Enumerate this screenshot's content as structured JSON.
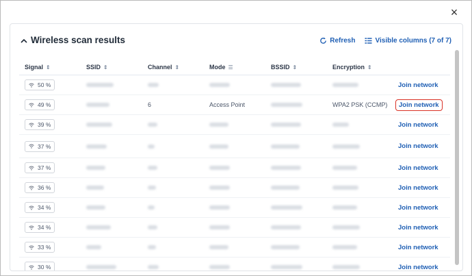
{
  "dialog": {
    "close_icon": "×"
  },
  "panel": {
    "title": "Wireless scan results",
    "refresh_label": "Refresh",
    "visible_columns_label": "Visible columns (7 of 7)"
  },
  "columns": [
    "Signal",
    "SSID",
    "Channel",
    "Mode",
    "BSSID",
    "Encryption"
  ],
  "rows": [
    {
      "signal": "50 %",
      "ssid": "",
      "channel": "",
      "mode": "",
      "bssid": "",
      "encryption": "",
      "join": "Join network"
    },
    {
      "signal": "49 %",
      "ssid": "",
      "channel": "6",
      "mode": "Access Point",
      "bssid": "",
      "encryption": "WPA2 PSK (CCMP)",
      "join": "Join network"
    },
    {
      "signal": "39 %",
      "ssid": "",
      "channel": "",
      "mode": "",
      "bssid": "",
      "encryption": "",
      "join": "Join network"
    },
    {
      "signal": "37 %",
      "ssid": "",
      "channel": "",
      "mode": "",
      "bssid": "",
      "encryption": "",
      "join": "Join network"
    },
    {
      "signal": "37 %",
      "ssid": "",
      "channel": "",
      "mode": "",
      "bssid": "",
      "encryption": "",
      "join": "Join network"
    },
    {
      "signal": "36 %",
      "ssid": "",
      "channel": "",
      "mode": "",
      "bssid": "",
      "encryption": "",
      "join": "Join network"
    },
    {
      "signal": "34 %",
      "ssid": "",
      "channel": "",
      "mode": "",
      "bssid": "",
      "encryption": "",
      "join": "Join network"
    },
    {
      "signal": "34 %",
      "ssid": "",
      "channel": "",
      "mode": "",
      "bssid": "",
      "encryption": "",
      "join": "Join network"
    },
    {
      "signal": "33 %",
      "ssid": "",
      "channel": "",
      "mode": "",
      "bssid": "",
      "encryption": "",
      "join": "Join network"
    },
    {
      "signal": "30 %",
      "ssid": "",
      "channel": "",
      "mode": "",
      "bssid": "",
      "encryption": "",
      "join": "Join network"
    }
  ],
  "colors": {
    "accent": "#1f5fb4",
    "highlight": "#d93025"
  },
  "icons": {
    "collapse": "chevron-up-icon",
    "refresh": "refresh-icon",
    "columns": "columns-icon",
    "signal": "wifi-icon",
    "sort": "sort-icon",
    "filter": "filter-icon"
  }
}
